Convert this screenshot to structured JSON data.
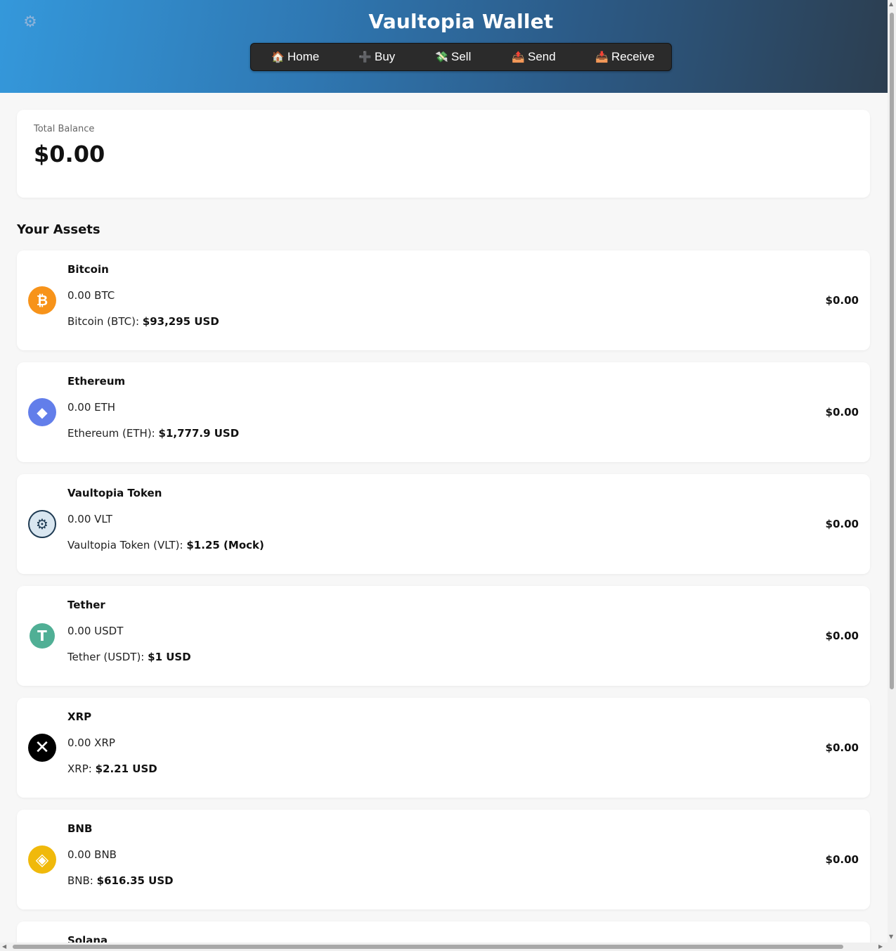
{
  "app": {
    "title": "Vaultopia Wallet"
  },
  "nav": [
    {
      "label": "Home",
      "icon": "house-icon",
      "glyph": "🏠"
    },
    {
      "label": "Buy",
      "icon": "plus-icon",
      "glyph": "➕"
    },
    {
      "label": "Sell",
      "icon": "money-wings-icon",
      "glyph": "💸"
    },
    {
      "label": "Send",
      "icon": "outbox-icon",
      "glyph": "📤"
    },
    {
      "label": "Receive",
      "icon": "inbox-icon",
      "glyph": "📥"
    }
  ],
  "balance": {
    "label": "Total Balance",
    "value": "$0.00"
  },
  "assets_title": "Your Assets",
  "assets": [
    {
      "name": "Bitcoin",
      "amount": "0.00 BTC",
      "price_label": "Bitcoin (BTC):",
      "price": "$93,295 USD",
      "value": "$0.00",
      "icon": "bitcoin-icon",
      "glyph": "₿",
      "color": "#f7931a"
    },
    {
      "name": "Ethereum",
      "amount": "0.00 ETH",
      "price_label": "Ethereum (ETH):",
      "price": "$1,777.9 USD",
      "value": "$0.00",
      "icon": "ethereum-icon",
      "glyph": "◆",
      "color": "#627eea"
    },
    {
      "name": "Vaultopia Token",
      "amount": "0.00 VLT",
      "price_label": "Vaultopia Token (VLT):",
      "price": "$1.25 (Mock)",
      "value": "$0.00",
      "icon": "vault-icon",
      "glyph": "⚙",
      "color": "#1e3a52"
    },
    {
      "name": "Tether",
      "amount": "0.00 USDT",
      "price_label": "Tether (USDT):",
      "price": "$1 USD",
      "value": "$0.00",
      "icon": "tether-icon",
      "glyph": "T",
      "color": "#50af95"
    },
    {
      "name": "XRP",
      "amount": "0.00 XRP",
      "price_label": "XRP:",
      "price": "$2.21 USD",
      "value": "$0.00",
      "icon": "xrp-icon",
      "glyph": "✕",
      "color": "#000000"
    },
    {
      "name": "BNB",
      "amount": "0.00 BNB",
      "price_label": "BNB:",
      "price": "$616.35 USD",
      "value": "$0.00",
      "icon": "bnb-icon",
      "glyph": "◈",
      "color": "#f0b90b"
    },
    {
      "name": "Solana",
      "amount": "",
      "price_label": "",
      "price": "",
      "value": "",
      "icon": "solana-icon",
      "glyph": "",
      "color": "#14f195"
    }
  ]
}
